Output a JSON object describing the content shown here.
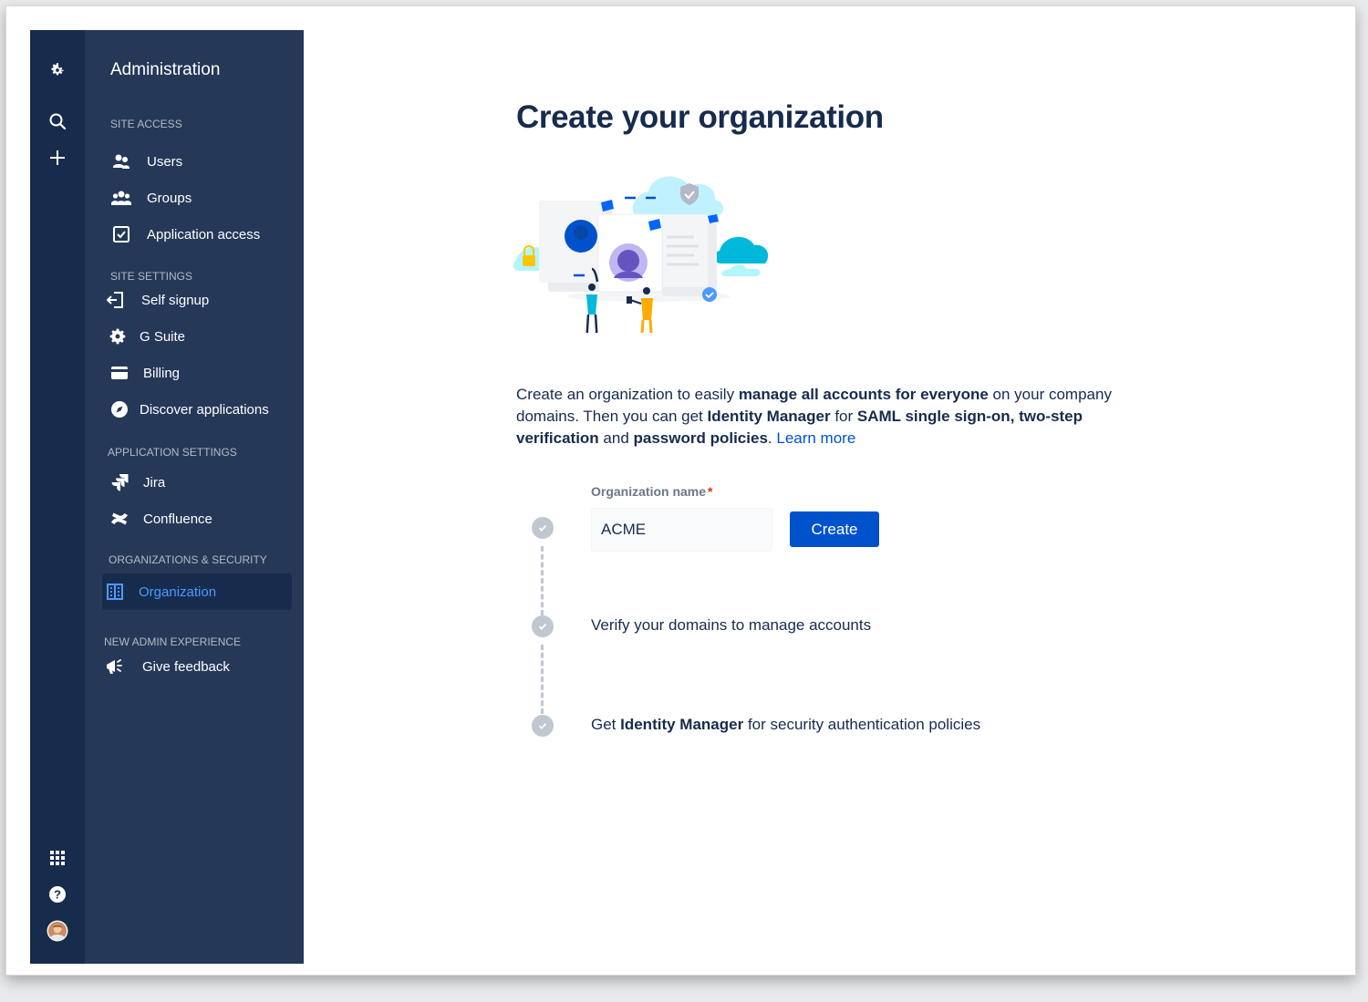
{
  "sidebar": {
    "title": "Administration",
    "sections": {
      "site_access": "SITE ACCESS",
      "site_settings": "SITE SETTINGS",
      "application_settings": "APPLICATION SETTINGS",
      "organizations_security": "ORGANIZATIONS & SECURITY",
      "new_admin_experience": "NEW ADMIN EXPERIENCE"
    },
    "items": {
      "users": "Users",
      "groups": "Groups",
      "application_access": "Application access",
      "self_signup": "Self signup",
      "g_suite": "G Suite",
      "billing": "Billing",
      "discover_applications": "Discover applications",
      "jira": "Jira",
      "confluence": "Confluence",
      "organization": "Organization",
      "give_feedback": "Give feedback"
    },
    "active_item": "Organization"
  },
  "main": {
    "title": "Create your organization",
    "description": {
      "p1": "Create an organization to easily ",
      "b1": "manage all accounts for everyone",
      "p2": " on your company domains. Then you can get ",
      "b2": "Identity Manager",
      "p3": " for ",
      "b3": "SAML single sign-on, two-step verification",
      "p4": " and ",
      "b4": "password policies",
      "p5": ". ",
      "link": "Learn more"
    },
    "form": {
      "label": "Organization name",
      "required_mark": "*",
      "value": "ACME",
      "create_label": "Create"
    },
    "steps": {
      "step2": "Verify your domains to manage accounts",
      "step3_prefix": "Get ",
      "step3_bold": "Identity Manager",
      "step3_suffix": " for security authentication policies"
    }
  },
  "colors": {
    "rail": "#172b4d",
    "sidebar": "#253858",
    "active_bg": "#172b4d",
    "active_text": "#4c9aff",
    "primary": "#0052cc",
    "heading": "#172b4d",
    "required": "#de350b"
  },
  "icons": [
    "gear-icon",
    "search-icon",
    "plus-icon",
    "app-switcher-icon",
    "help-icon",
    "avatar",
    "users-icon",
    "groups-icon",
    "checkbox-icon",
    "sign-in-icon",
    "gear-icon",
    "credit-card-icon",
    "compass-icon",
    "jira-icon",
    "confluence-icon",
    "office-building-icon",
    "megaphone-icon",
    "check-icon"
  ]
}
